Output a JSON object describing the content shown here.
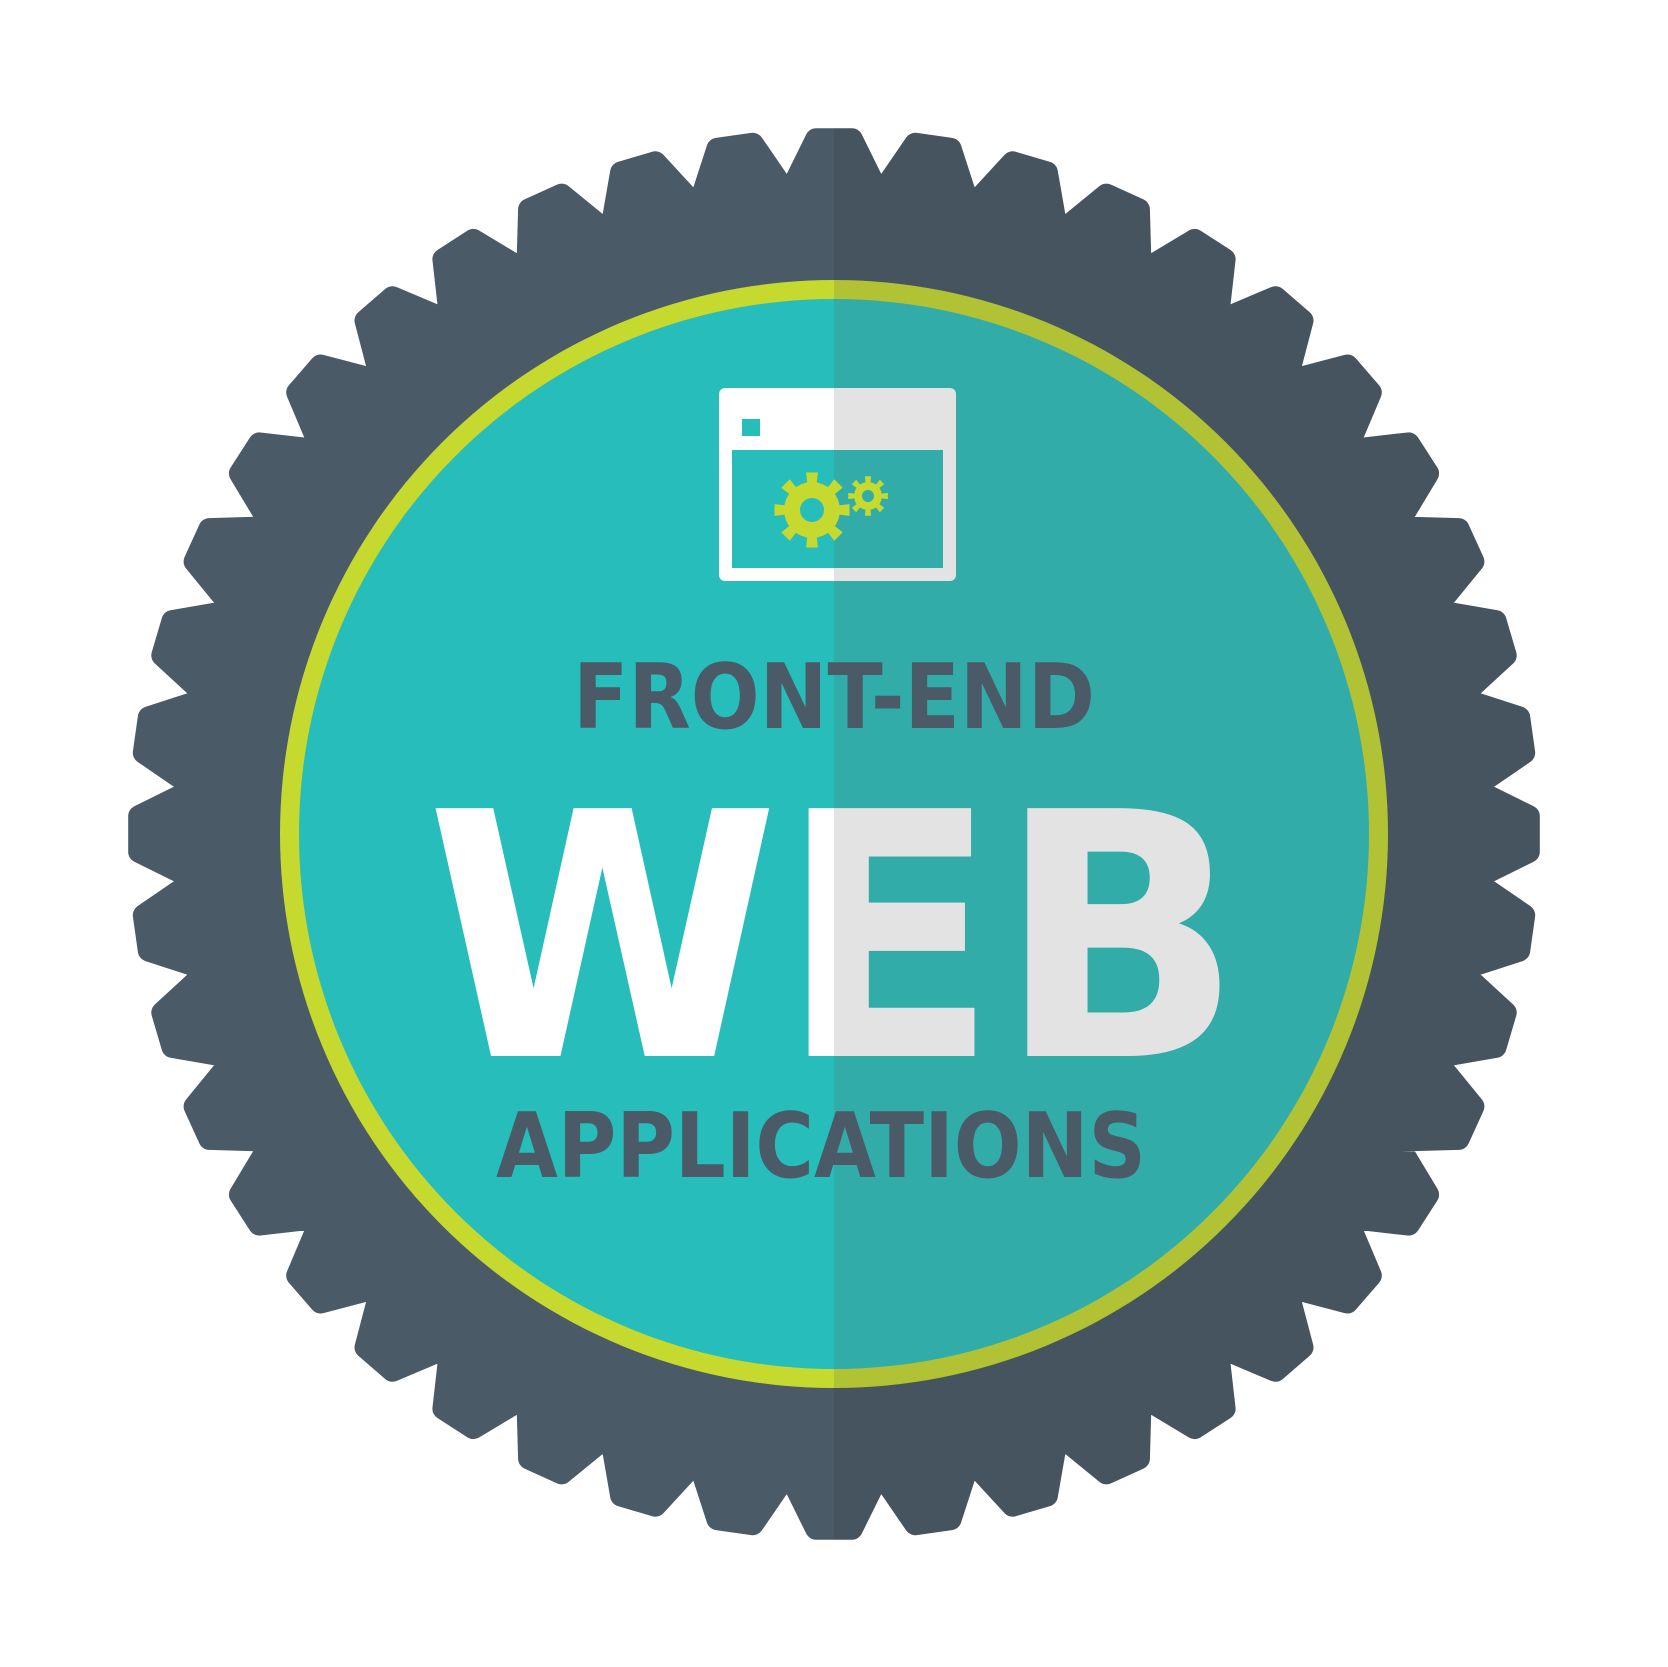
{
  "badge": {
    "top_text": "FRONT-END",
    "main_text": "WEB",
    "bottom_text": "APPLICATIONS",
    "icon": "browser-window-gears-icon",
    "tooth_count": 44
  },
  "colors": {
    "background": "#ffffff",
    "gear_light": "#4a5a66",
    "gear_dark": "#45545f",
    "ring_light": "#c5d92e",
    "ring_dark": "#b1c235",
    "disc_light": "#26bdbb",
    "disc_dark": "#32aca9",
    "text_dark": "#4a5a66",
    "text_white": "#ffffff",
    "text_grey": "#e4e3e4",
    "window_white": "#ffffff",
    "window_grey": "#e4e3e4",
    "gear_icon": "#c5d92e"
  }
}
